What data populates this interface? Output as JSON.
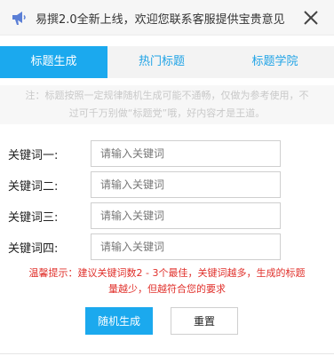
{
  "notice": {
    "text": "易撰2.0全新上线，欢迎您联系客服提供宝贵意见",
    "icon": "megaphone-icon",
    "close_icon": "close-icon"
  },
  "tabs": [
    {
      "label": "标题生成",
      "active": true
    },
    {
      "label": "热门标题",
      "active": false
    },
    {
      "label": "标题学院",
      "active": false
    }
  ],
  "tip": {
    "line1": "注：标题按照一定规律随机生成可能不通畅，仅做为参考使用，不",
    "line2": "过可千万别做“标题党”哦，好内容才是王道。"
  },
  "form": {
    "fields": [
      {
        "label": "关键词一:",
        "placeholder": "请输入关键词",
        "value": ""
      },
      {
        "label": "关键词二:",
        "placeholder": "请输入关键词",
        "value": ""
      },
      {
        "label": "关键词三:",
        "placeholder": "请输入关键词",
        "value": ""
      },
      {
        "label": "关键词四:",
        "placeholder": "请输入关键词",
        "value": ""
      }
    ]
  },
  "warm_tip": {
    "line1": "温馨提示：建议关键词数2 - 3个最佳，关键词越多，生成的标题",
    "line2": "量越少，但越符合您的要求"
  },
  "buttons": {
    "generate": "随机生成",
    "reset": "重置"
  },
  "colors": {
    "accent": "#1ba9ee",
    "warning": "#e0302b"
  }
}
